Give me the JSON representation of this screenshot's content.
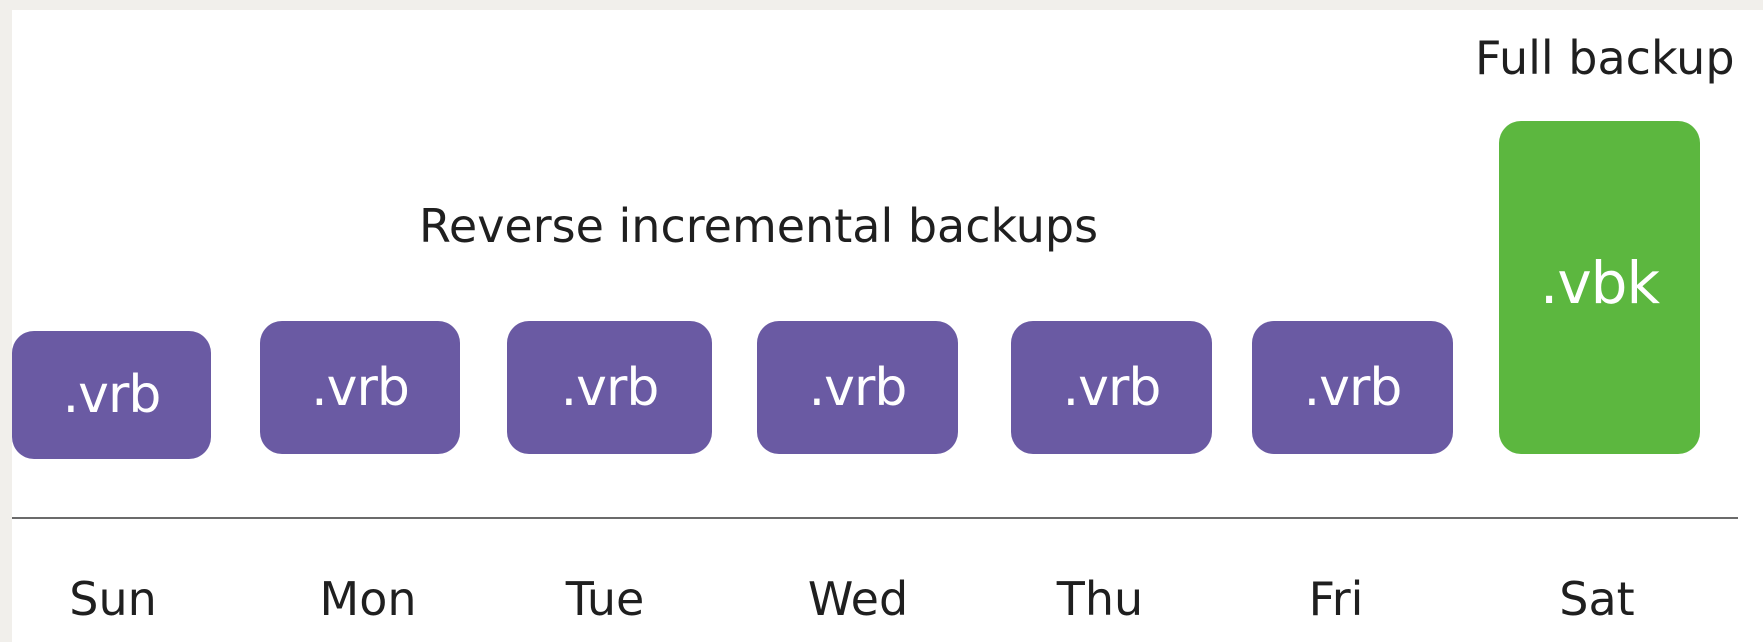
{
  "diagram": {
    "full_backup_label": "Full backup",
    "reverse_incremental_label": "Reverse incremental backups",
    "tiles": [
      {
        "text": ".vrb",
        "day": "Sun",
        "type": "reverse-incremental",
        "color": "#6a5aa3"
      },
      {
        "text": ".vrb",
        "day": "Mon",
        "type": "reverse-incremental",
        "color": "#6a5aa3"
      },
      {
        "text": ".vrb",
        "day": "Tue",
        "type": "reverse-incremental",
        "color": "#6a5aa3"
      },
      {
        "text": ".vrb",
        "day": "Wed",
        "type": "reverse-incremental",
        "color": "#6a5aa3"
      },
      {
        "text": ".vrb",
        "day": "Thu",
        "type": "reverse-incremental",
        "color": "#6a5aa3"
      },
      {
        "text": ".vrb",
        "day": "Fri",
        "type": "reverse-incremental",
        "color": "#6a5aa3"
      },
      {
        "text": ".vbk",
        "day": "Sat",
        "type": "full",
        "color": "#5cb73f"
      }
    ]
  }
}
